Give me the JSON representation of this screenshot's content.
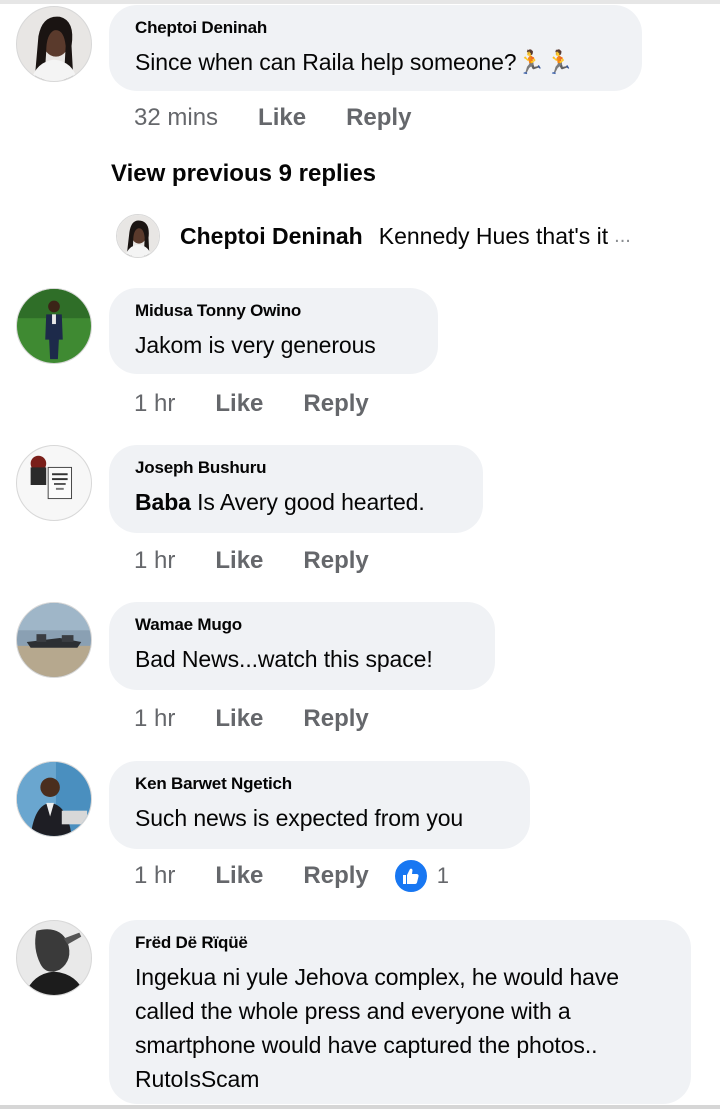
{
  "comments": [
    {
      "author": "Cheptoi Deninah",
      "text": "Since when can Raila help someone?",
      "emoji": "🏃🏃",
      "time": "32 mins",
      "like": "Like",
      "reply": "Reply"
    },
    {
      "author": "Midusa Tonny Owino",
      "text": "Jakom is very generous",
      "time": "1 hr",
      "like": "Like",
      "reply": "Reply"
    },
    {
      "author": "Joseph Bushuru",
      "text_bold": "Baba",
      "text": " Is Avery good hearted.",
      "time": "1 hr",
      "like": "Like",
      "reply": "Reply"
    },
    {
      "author": "Wamae Mugo",
      "text": "Bad News...watch this space!",
      "time": "1 hr",
      "like": "Like",
      "reply": "Reply"
    },
    {
      "author": "Ken Barwet Ngetich",
      "text": "Such news is expected from you",
      "time": "1 hr",
      "like": "Like",
      "reply": "Reply",
      "reaction_count": "1"
    },
    {
      "author": "Frëd Dë Rïqüë",
      "text_lines": [
        "Ingekua ni yule Jehova complex, he would have",
        "called the whole press and everyone with a",
        "smartphone would have captured the photos..",
        "RutoIsScam"
      ]
    }
  ],
  "view_previous": "View previous 9 replies",
  "reply_preview": {
    "author": "Cheptoi Deninah",
    "text": "Kennedy Hues that's it",
    "ellipsis": "..."
  },
  "icons": {
    "like_reaction": "thumbs-up-icon",
    "like_color": "#1877f2"
  }
}
